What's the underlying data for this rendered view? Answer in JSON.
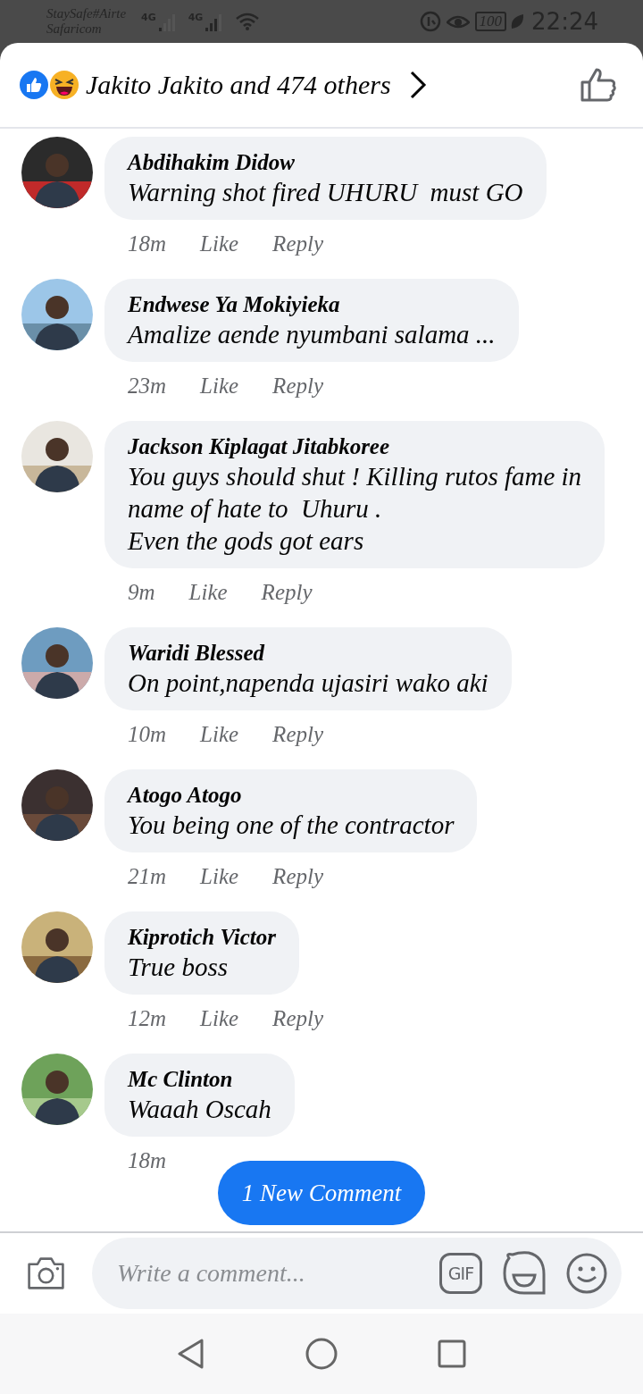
{
  "status_bar": {
    "carriers": [
      "StaySafe#Airte",
      "Safaricom"
    ],
    "networks": [
      "4G",
      "4G"
    ],
    "battery": "100",
    "time": "22:24"
  },
  "reactions_header": {
    "summary": "Jakito Jakito and 474 others"
  },
  "comments": [
    {
      "author": "Abdihakim Didow",
      "lines": [
        "Warning shot fired UHURU  must GO"
      ],
      "time": "18m",
      "like": "Like",
      "reply": "Reply"
    },
    {
      "author": "Endwese Ya Mokiyieka",
      "lines": [
        "Amalize aende nyumbani salama ..."
      ],
      "time": "23m",
      "like": "Like",
      "reply": "Reply"
    },
    {
      "author": "Jackson Kiplagat Jitabkoree",
      "lines": [
        "You guys should shut ! Killing rutos fame in",
        "name of hate to  Uhuru .",
        "Even the gods got ears"
      ],
      "time": "9m",
      "like": "Like",
      "reply": "Reply"
    },
    {
      "author": "Waridi Blessed",
      "lines": [
        "On point,napenda ujasiri wako aki"
      ],
      "time": "10m",
      "like": "Like",
      "reply": "Reply"
    },
    {
      "author": "Atogo Atogo",
      "lines": [
        "You being one of the contractor"
      ],
      "time": "21m",
      "like": "Like",
      "reply": "Reply"
    },
    {
      "author": "Kiprotich Victor",
      "lines": [
        "True boss"
      ],
      "time": "12m",
      "like": "Like",
      "reply": "Reply"
    },
    {
      "author": "Mc Clinton",
      "lines": [
        "Waaah Oscah"
      ],
      "time": "18m"
    }
  ],
  "new_comment_button": "1 New Comment",
  "composer": {
    "placeholder": "Write a comment...",
    "gif_label": "GIF"
  }
}
